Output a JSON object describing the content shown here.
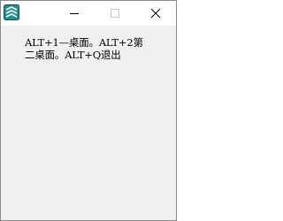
{
  "window": {
    "message": "ALT+1—桌面。ALT+2第\n二桌面。ALT+Q退出"
  },
  "titlebar": {
    "app_icon": "app-icon",
    "minimize_icon": "minimize-icon",
    "maximize_icon": "maximize-icon",
    "close_icon": "close-icon"
  },
  "colors": {
    "icon_teal": "#1e8f8a",
    "icon_dark": "#1d4f5c",
    "disabled_gray": "#c8c8c8",
    "text": "#000000"
  }
}
